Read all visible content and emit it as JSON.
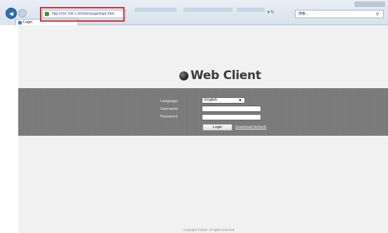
{
  "browser": {
    "address_url": "http://192.168.1.160/doc/page/login.html",
    "tab_title": "Login",
    "search_placeholder": "搜索...",
    "refresh_label": "▾ ↻"
  },
  "logo": {
    "title": "Web Client"
  },
  "login_form": {
    "language_label": "Language",
    "username_label": "Username",
    "password_label": "Password",
    "language_value": "English",
    "username_value": "",
    "password_value": "",
    "login_label": "Login",
    "download_label": "Download ActiveX"
  },
  "footer": {
    "text": "Copyright ©2015. All rights reserved."
  },
  "colors": {
    "band": "#787878",
    "highlight": "#d8302f",
    "page_bg": "#f1f1f2"
  }
}
